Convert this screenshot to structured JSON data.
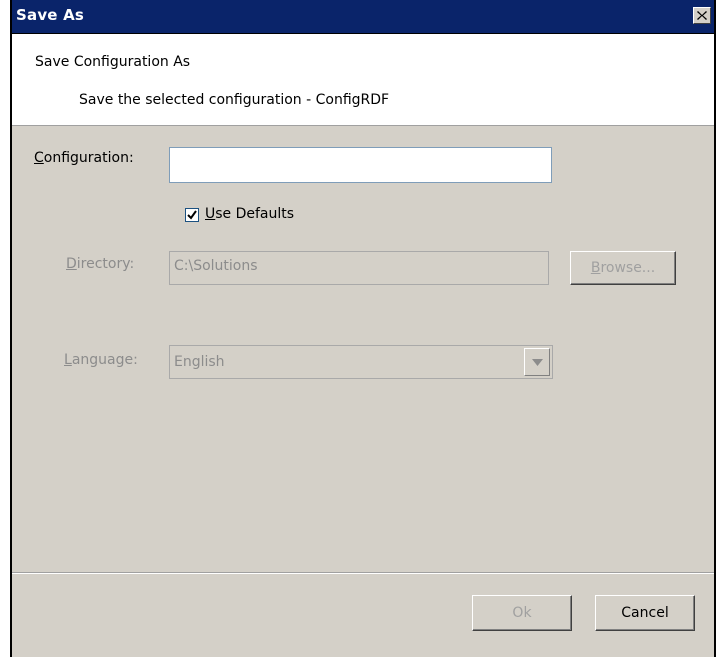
{
  "window": {
    "title": "Save As"
  },
  "header": {
    "title": "Save Configuration As",
    "description": "Save the selected configuration - ConfigRDF"
  },
  "form": {
    "configuration": {
      "label_hotkey": "C",
      "label_rest": "onfiguration:",
      "value": ""
    },
    "use_defaults": {
      "label_hotkey": "U",
      "label_rest": "se Defaults",
      "checked": true
    },
    "directory": {
      "label_hotkey": "D",
      "label_rest": "irectory:",
      "value": "C:\\Solutions",
      "enabled": false
    },
    "browse_button": {
      "label_hotkey": "B",
      "label_rest": "rowse...",
      "enabled": false
    },
    "language": {
      "label_hotkey": "L",
      "label_rest": "anguage:",
      "selected": "English",
      "enabled": false
    }
  },
  "footer": {
    "ok_label": "Ok",
    "ok_enabled": false,
    "cancel_label": "Cancel"
  },
  "icons": {
    "close": "close-icon",
    "checkmark": "checkmark-icon",
    "dropdown": "chevron-down-icon"
  },
  "colors": {
    "titlebar": "#0a246a",
    "dialog_bg": "#d4d0c8",
    "disabled_text": "#8c8c8c"
  }
}
